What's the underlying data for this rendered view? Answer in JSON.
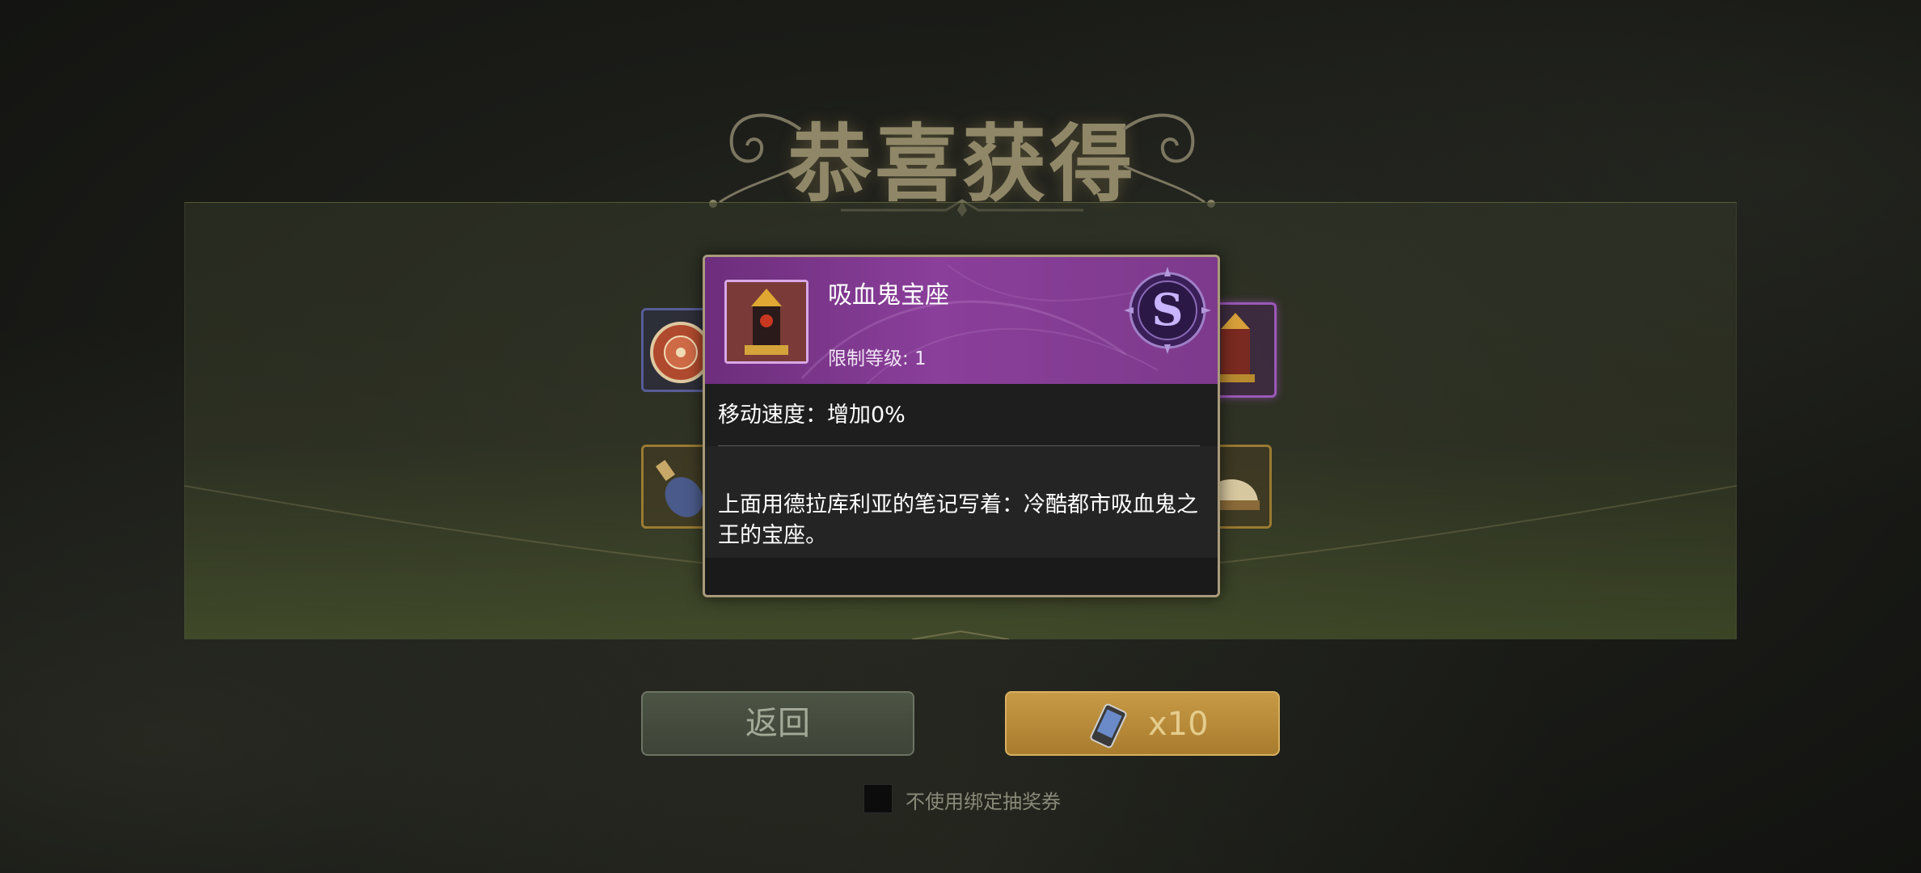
{
  "title": "恭喜获得",
  "reward_slots": {
    "row1": [
      {
        "icon": "round-shield-icon",
        "rarity": "blue"
      },
      {
        "icon": "empty-slot",
        "rarity": "dim"
      },
      {
        "icon": "empty-slot",
        "rarity": "dim"
      },
      {
        "icon": "empty-slot",
        "rarity": "dim"
      },
      {
        "icon": "vampire-throne-icon",
        "rarity": "purple"
      }
    ],
    "row2": [
      {
        "icon": "potion-bottle-icon",
        "rarity": "gold"
      },
      {
        "icon": "scroll-icon",
        "rarity": "dim"
      },
      {
        "icon": "cloth-icon",
        "rarity": "dim"
      },
      {
        "icon": "bottle-icon",
        "rarity": "dim"
      },
      {
        "icon": "helmet-icon",
        "rarity": "gold"
      }
    ]
  },
  "tooltip": {
    "item_name": "吸血鬼宝座",
    "level_requirement": "限制等级: 1",
    "rank": "S",
    "stat": "移动速度：增加0%",
    "description": "上面用德拉库利亚的笔记写着：冷酷都市吸血鬼之王的宝座。"
  },
  "buttons": {
    "back_label": "返回",
    "draw_count": "x10",
    "draw_icon": "phone-ticket-icon"
  },
  "checkbox": {
    "label": "不使用绑定抽奖券",
    "checked": false
  },
  "colors": {
    "rarity_purple": "#9a58b8",
    "rarity_gold": "#9a7a32",
    "rarity_blue": "#585c96",
    "draw_button": "#c79a46"
  }
}
